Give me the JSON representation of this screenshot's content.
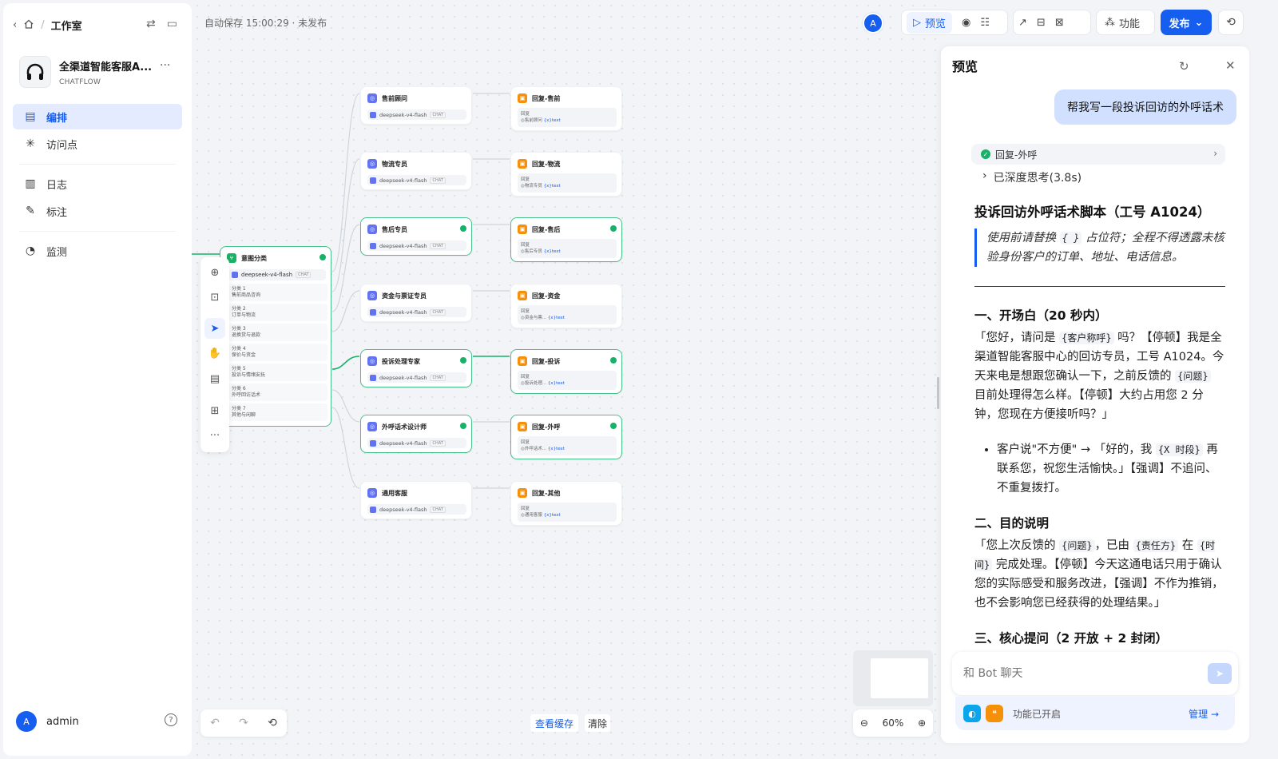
{
  "breadcrumb": {
    "workspace": "工作室"
  },
  "app": {
    "name": "全渠道智能客服A...",
    "type": "CHATFLOW"
  },
  "nav": [
    {
      "label": "编排",
      "icon": "orchestrate-icon",
      "active": true
    },
    {
      "label": "访问点",
      "icon": "access-point-icon"
    },
    {
      "label": "日志",
      "icon": "log-icon"
    },
    {
      "label": "标注",
      "icon": "annotation-icon"
    },
    {
      "label": "监测",
      "icon": "monitor-icon"
    }
  ],
  "user": {
    "initial": "A",
    "name": "admin"
  },
  "canvas": {
    "autosave": "自动保存 15:00:29 · 未发布"
  },
  "toolbar": {
    "avatar_initial": "A",
    "preview_label": "预览",
    "features_label": "功能",
    "publish_label": "发布"
  },
  "classifier": {
    "title": "意图分类",
    "model": "deepseek-v4-flash",
    "model_tag": "CHAT",
    "classes": [
      {
        "name": "分类 1",
        "desc": "售前商品咨询"
      },
      {
        "name": "分类 2",
        "desc": "订单与物流"
      },
      {
        "name": "分类 3",
        "desc": "退换货与退款"
      },
      {
        "name": "分类 4",
        "desc": "保价与资金"
      },
      {
        "name": "分类 5",
        "desc": "投诉与情绪安抚"
      },
      {
        "name": "分类 6",
        "desc": "外呼回访话术"
      },
      {
        "name": "分类 7",
        "desc": "其他与闲聊"
      }
    ]
  },
  "llm_nodes": [
    {
      "title": "售前顾问",
      "model": "deepseek-v4-flash",
      "tag": "CHAT",
      "done": false
    },
    {
      "title": "物流专员",
      "model": "deepseek-v4-flash",
      "tag": "CHAT",
      "done": false
    },
    {
      "title": "售后专员",
      "model": "deepseek-v4-flash",
      "tag": "CHAT",
      "done": true
    },
    {
      "title": "资金与票证专员",
      "model": "deepseek-v4-flash",
      "tag": "CHAT",
      "done": false
    },
    {
      "title": "投诉处理专家",
      "model": "deepseek-v4-flash",
      "tag": "CHAT",
      "done": true
    },
    {
      "title": "外呼话术设计师",
      "model": "deepseek-v4-flash",
      "tag": "CHAT",
      "done": true
    },
    {
      "title": "通用客服",
      "model": "deepseek-v4-flash",
      "tag": "CHAT",
      "done": false
    }
  ],
  "answer_nodes": [
    {
      "title": "回复-售前",
      "label": "回复",
      "ref": "售前顾问",
      "var": "{x}text",
      "done": false
    },
    {
      "title": "回复-物流",
      "label": "回复",
      "ref": "物流专员",
      "var": "{x}text",
      "done": false
    },
    {
      "title": "回复-售后",
      "label": "回复",
      "ref": "售后专员",
      "var": "{x}text",
      "done": true
    },
    {
      "title": "回复-资金",
      "label": "回复",
      "ref": "资金与票...",
      "var": "{x}text",
      "done": false
    },
    {
      "title": "回复-投诉",
      "label": "回复",
      "ref": "投诉处理...",
      "var": "{x}text",
      "done": true
    },
    {
      "title": "回复-外呼",
      "label": "回复",
      "ref": "外呼话术...",
      "var": "{x}text",
      "done": true
    },
    {
      "title": "回复-其他",
      "label": "回复",
      "ref": "通用客服",
      "var": "{x}text",
      "done": false
    }
  ],
  "bottom": {
    "view_cache": "查看缓存",
    "clear": "清除",
    "zoom": "60%"
  },
  "preview": {
    "title": "预览",
    "user_message": "帮我写一段投诉回访的外呼话术",
    "workflow_step": "回复-外呼",
    "thinking": "已深度思考(3.8s)",
    "heading": "投诉回访外呼话术脚本（工号 A1024）",
    "quote_pre": "使用前请替换",
    "quote_code": "{ }",
    "quote_post": "占位符；全程不得透露未核验身份客户的订单、地址、电话信息。",
    "s1_title": "一、开场白（20 秒内）",
    "s1_p_a": "「您好，请问是",
    "s1_code_a": "{客户称呼}",
    "s1_p_b": "吗？【停顿】我是全渠道智能客服中心的回访专员，工号 A1024。今天来电是想跟您确认一下，之前反馈的",
    "s1_code_b": "{问题}",
    "s1_p_c": "目前处理得怎么样。【停顿】大约占用您 2 分钟，您现在方便接听吗？」",
    "s1_li_a": "客户说\"不方便\" → 「好的，我",
    "s1_li_code": "{X 时段}",
    "s1_li_b": "再联系您，祝您生活愉快。」【强调】不追问、不重复拨打。",
    "s2_title": "二、目的说明",
    "s2_p_a": "「您上次反馈的",
    "s2_code_a": "{问题}",
    "s2_p_b": "，已由",
    "s2_code_b": "{责任方}",
    "s2_p_c": "在",
    "s2_code_c": "{时间}",
    "s2_p_d": "完成处理。【停顿】今天这通电话只用于确认您的实际感受和服务改进，【强调】不作为推销，也不会影响您已经获得的处理结果。」",
    "s3_title": "三、核心提问（2 开放 + 2 封闭）",
    "input_placeholder": "和 Bot 聊天",
    "features_text": "功能已开启",
    "manage_label": "管理"
  }
}
